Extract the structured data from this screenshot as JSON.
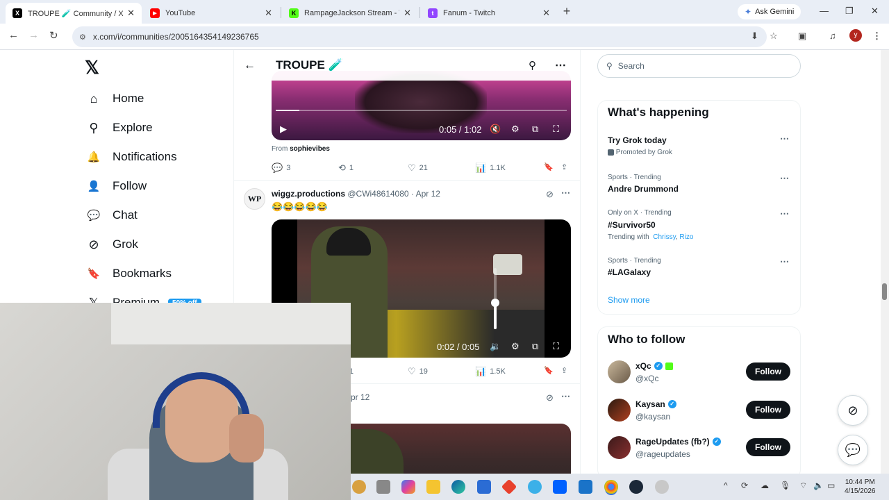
{
  "browser": {
    "tabs": [
      {
        "label": "TROUPE 🧪 Community / X",
        "favicon": "X",
        "color": "#000000"
      },
      {
        "label": "YouTube",
        "favicon": "▶",
        "color": "#ff0000"
      },
      {
        "label": "RampageJackson Stream - Wat",
        "favicon": "K",
        "color": "#53fc18"
      },
      {
        "label": "Fanum - Twitch",
        "favicon": "t",
        "color": "#9146ff"
      }
    ],
    "new_tab": "+",
    "ask_gemini": "Ask Gemini",
    "url": "x.com/i/communities/2005164354149236765",
    "profile_initial": "y"
  },
  "nav": {
    "logo": "𝕏",
    "items": [
      {
        "label": "Home",
        "icon": "⌂"
      },
      {
        "label": "Explore",
        "icon": "⚲"
      },
      {
        "label": "Notifications",
        "icon": "🔔"
      },
      {
        "label": "Follow",
        "icon": "👤"
      },
      {
        "label": "Chat",
        "icon": "💬"
      },
      {
        "label": "Grok",
        "icon": "⊘"
      },
      {
        "label": "Bookmarks",
        "icon": "🔖"
      },
      {
        "label": "Premium",
        "icon": "𝕏"
      }
    ],
    "premium_badge": "50% off"
  },
  "community": {
    "title": "TROUPE 🧪"
  },
  "post1": {
    "video_time": "0:05 / 1:02",
    "from_label": "From",
    "from_user": "sophievibes",
    "replies": "3",
    "reposts": "1",
    "likes": "21",
    "views": "1.1K"
  },
  "post2": {
    "name": "wiggz.productions",
    "handle": "@CWi48614080",
    "date": "· Apr 12",
    "avatar_text": "WP",
    "text": "😂😂😂😂😂",
    "video_time": "0:02 / 0:05",
    "volume_level": 0.5,
    "replies": "1",
    "likes": "19",
    "views": "1.5K"
  },
  "post3": {
    "date": "pr 12"
  },
  "right": {
    "search_placeholder": "Search",
    "whats_happening": "What's happening",
    "trends": [
      {
        "context": "",
        "name": "Try Grok today",
        "sub": "Promoted by Grok"
      },
      {
        "context": "Sports · Trending",
        "name": "Andre Drummond",
        "sub": ""
      },
      {
        "context": "Only on X · Trending",
        "name": "#Survivor50",
        "sub": "Trending with",
        "links": [
          "Chrissy",
          "Rizo"
        ]
      },
      {
        "context": "Sports · Trending",
        "name": "#LAGalaxy",
        "sub": ""
      }
    ],
    "show_more": "Show more",
    "who_to_follow": "Who to follow",
    "accounts": [
      {
        "name": "xQc",
        "handle": "@xQc",
        "button": "Follow"
      },
      {
        "name": "Kaysan",
        "handle": "@kaysan",
        "button": "Follow"
      },
      {
        "name": "RageUpdates (fb?)",
        "handle": "@rageupdates",
        "button": "Follow"
      }
    ]
  },
  "taskbar": {
    "time": "10:44 PM",
    "date": "4/15/2026"
  }
}
